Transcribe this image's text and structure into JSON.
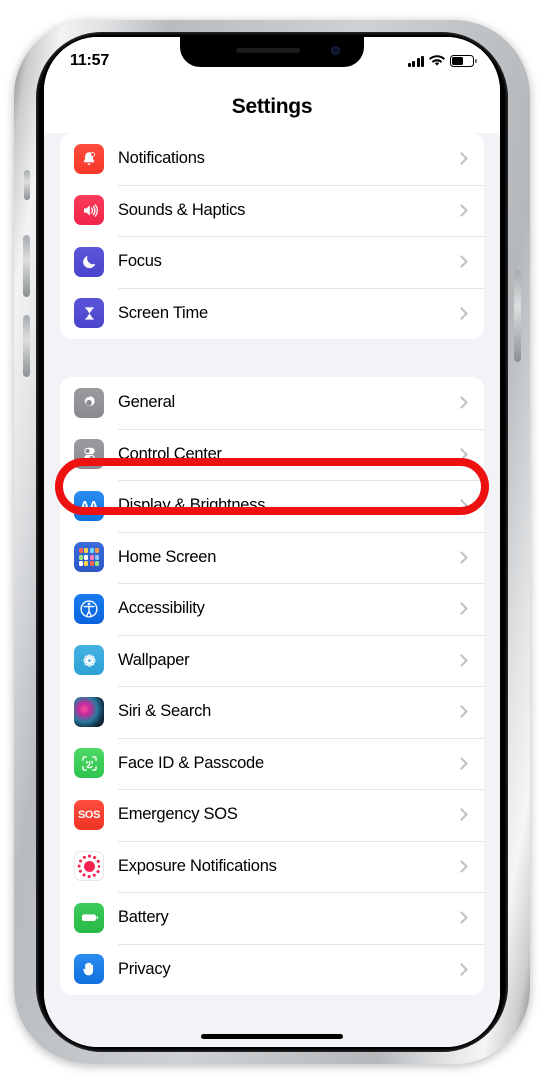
{
  "device": {
    "name": "iphone-frame",
    "body_color": "#cfd2d4",
    "bezel_color": "#000000"
  },
  "status_bar": {
    "time": "11:57",
    "signal_icon": "cellular-signal-icon",
    "signal_bars_filled": 4,
    "wifi_icon": "wifi-icon",
    "battery_icon": "battery-icon",
    "battery_level_percent": 55
  },
  "nav": {
    "title": "Settings"
  },
  "annotation": {
    "type": "red-rounded-rectangle-highlight",
    "color": "#ee1111",
    "target": "Control Center"
  },
  "groups": [
    {
      "id": "group-alerts",
      "rows": [
        {
          "label": "Notifications",
          "icon": "bell-icon",
          "icon_class": "ic-notifications",
          "icon_glyph": "🔔",
          "color": "#ff4d3d",
          "highlighted": false
        },
        {
          "label": "Sounds & Haptics",
          "icon": "speaker-waves-icon",
          "icon_class": "ic-sounds",
          "icon_glyph": "🔊",
          "color": "#fb3b59",
          "highlighted": false
        },
        {
          "label": "Focus",
          "icon": "crescent-moon-icon",
          "icon_class": "ic-focus",
          "icon_glyph": "☾",
          "color": "#5a55d8",
          "highlighted": false
        },
        {
          "label": "Screen Time",
          "icon": "hourglass-icon",
          "icon_class": "ic-screentime",
          "icon_glyph": "⌛",
          "color": "#5a55d8",
          "highlighted": false
        }
      ]
    },
    {
      "id": "group-system",
      "rows": [
        {
          "label": "General",
          "icon": "gear-icon",
          "icon_class": "ic-general",
          "icon_glyph": "⚙",
          "color": "#9b9b9f",
          "highlighted": false
        },
        {
          "label": "Control Center",
          "icon": "control-toggles-icon",
          "icon_class": "ic-controlcenter",
          "icon_glyph": "",
          "color": "#9b9b9f",
          "highlighted": true
        },
        {
          "label": "Display & Brightness",
          "icon": "aa-text-icon",
          "icon_class": "ic-display",
          "icon_glyph": "AA",
          "color": "#2a8cf0",
          "highlighted": false
        },
        {
          "label": "Home Screen",
          "icon": "app-grid-icon",
          "icon_class": "ic-homescreen",
          "icon_glyph": "",
          "color": "#3b6ddb",
          "highlighted": false
        },
        {
          "label": "Accessibility",
          "icon": "accessibility-icon",
          "icon_class": "ic-accessibility",
          "icon_glyph": "",
          "color": "#1a7cf0",
          "highlighted": false
        },
        {
          "label": "Wallpaper",
          "icon": "flower-icon",
          "icon_class": "ic-wallpaper",
          "icon_glyph": "",
          "color": "#44b3e3",
          "highlighted": false
        },
        {
          "label": "Siri & Search",
          "icon": "siri-orb-icon",
          "icon_class": "ic-siri",
          "icon_glyph": "",
          "color": "#c22b9c",
          "highlighted": false
        },
        {
          "label": "Face ID & Passcode",
          "icon": "face-id-icon",
          "icon_class": "ic-faceid",
          "icon_glyph": "",
          "color": "#4cd964",
          "highlighted": false
        },
        {
          "label": "Emergency SOS",
          "icon": "sos-icon",
          "icon_class": "ic-sos",
          "icon_glyph": "SOS",
          "color": "#ff4d3d",
          "highlighted": false
        },
        {
          "label": "Exposure Notifications",
          "icon": "exposure-dots-icon",
          "icon_class": "ic-exposure",
          "icon_glyph": "",
          "color": "#f5234f",
          "highlighted": false
        },
        {
          "label": "Battery",
          "icon": "battery-icon",
          "icon_class": "ic-battery",
          "icon_glyph": "",
          "color": "#3ecb5c",
          "highlighted": false
        },
        {
          "label": "Privacy",
          "icon": "raised-hand-icon",
          "icon_class": "ic-privacy",
          "icon_glyph": "✋",
          "color": "#2a8cf0",
          "highlighted": false
        }
      ]
    }
  ],
  "home_indicator": {
    "name": "home-indicator"
  }
}
